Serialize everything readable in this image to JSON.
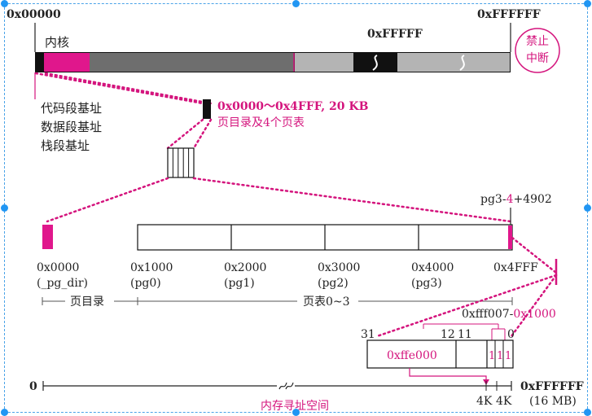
{
  "memory_bar": {
    "addr_start": "0x00000",
    "addr_end": "0xFFFFFF",
    "addr_mid": "0xFFFFF",
    "kernel_label": "内核",
    "nmi_label_line1": "禁止",
    "nmi_label_line2": "中断",
    "base_labels": [
      "代码段基址",
      "数据段基址",
      "栈段基址"
    ]
  },
  "zoom1": {
    "range_label": "0x0000～0x4FFF, 20 KB",
    "desc_label": "页目录及4个页表"
  },
  "page_tables": {
    "top_right_label": "pg3-4+4902",
    "top_right_parts": [
      "pg3-",
      "4",
      "+4902"
    ],
    "addresses": [
      "0x0000",
      "0x1000",
      "0x2000",
      "0x3000",
      "0x4000",
      "0x4FFF"
    ],
    "names": [
      "(_pg_dir)",
      "(pg0)",
      "(pg1)",
      "(pg2)",
      "(pg3)"
    ],
    "dir_label": "页目录",
    "tables_label": "页表0~3"
  },
  "pte": {
    "value_label": "0xfff007-0x1000",
    "value_parts": [
      "0xfff007-",
      "0x1000"
    ],
    "bit_31": "31",
    "bit_12": "12",
    "bit_11": "11",
    "bit_0": "0",
    "frame_value": "0xffe000",
    "flag_bits": [
      "1",
      "1",
      "1"
    ]
  },
  "address_space": {
    "start": "0",
    "end": "0xFFFFFF",
    "end_note": "(16 MB)",
    "tick_label_a": "4K",
    "tick_label_b": "4K",
    "caption": "内存寻址空间"
  },
  "colors": {
    "accent": "#d4147d",
    "dark_gray": "#6e6e6e",
    "light_gray": "#b4b4b4",
    "black": "#111111",
    "selection": "#2196f3"
  }
}
